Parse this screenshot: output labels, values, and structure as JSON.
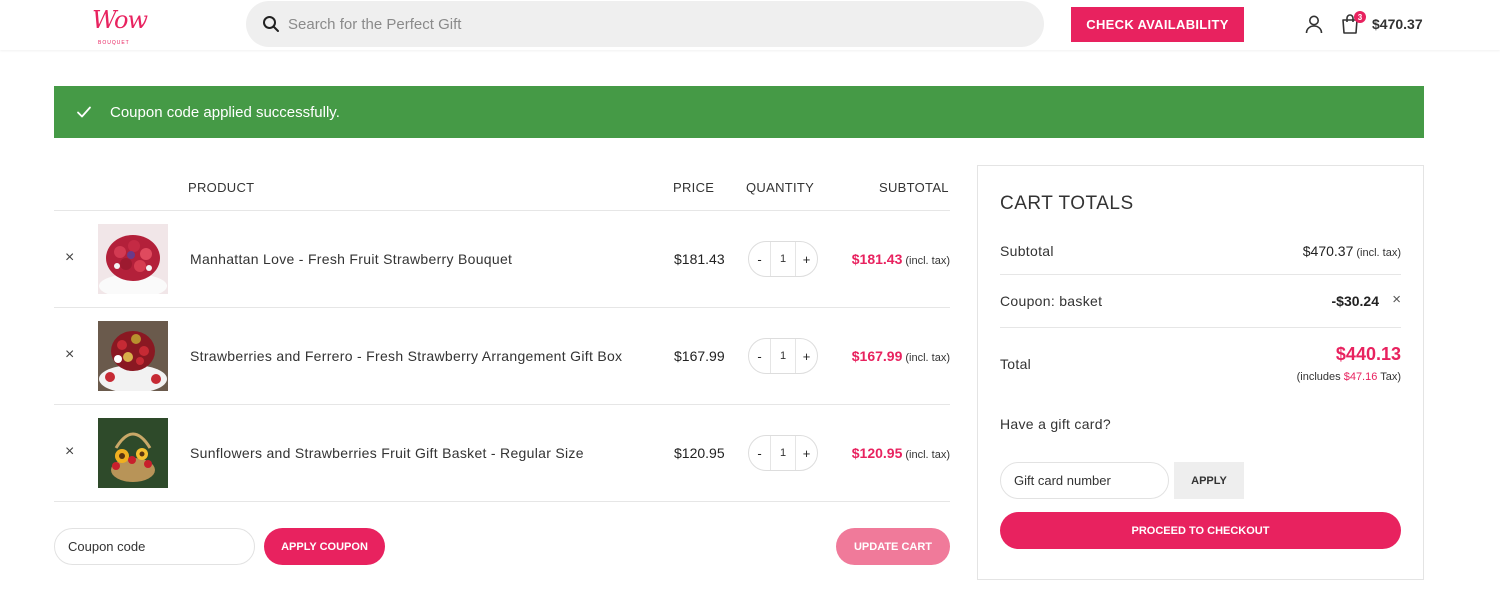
{
  "header": {
    "logo_text": "Wow",
    "logo_tagline": "BOUQUET",
    "search_placeholder": "Search for the Perfect Gift",
    "check_availability_label": "CHECK AVAILABILITY",
    "cart_count": "3",
    "cart_total": "$470.37"
  },
  "notice": {
    "message": "Coupon code applied successfully.",
    "color": "#459a46"
  },
  "table": {
    "headers": {
      "product": "PRODUCT",
      "price": "PRICE",
      "quantity": "QUANTITY",
      "subtotal": "SUBTOTAL"
    },
    "rows": [
      {
        "remove": "×",
        "name": "Manhattan Love - Fresh Fruit Strawberry Bouquet",
        "price": "$181.43",
        "qty_minus": "-",
        "qty": "1",
        "qty_plus": "+",
        "subtotal": "$181.43",
        "tax_note": "(incl. tax)"
      },
      {
        "remove": "×",
        "name": "Strawberries and Ferrero - Fresh Strawberry Arrangement Gift Box",
        "price": "$167.99",
        "qty_minus": "-",
        "qty": "1",
        "qty_plus": "+",
        "subtotal": "$167.99",
        "tax_note": "(incl. tax)"
      },
      {
        "remove": "×",
        "name": "Sunflowers and Strawberries Fruit Gift Basket - Regular Size",
        "price": "$120.95",
        "qty_minus": "-",
        "qty": "1",
        "qty_plus": "+",
        "subtotal": "$120.95",
        "tax_note": "(incl. tax)"
      }
    ]
  },
  "actions": {
    "coupon_placeholder": "Coupon code",
    "apply_coupon_label": "APPLY COUPON",
    "update_cart_label": "UPDATE CART"
  },
  "totals": {
    "title": "CART TOTALS",
    "subtotal_label": "Subtotal",
    "subtotal_value": "$470.37",
    "subtotal_tax": "(incl. tax)",
    "coupon_label": "Coupon: basket",
    "coupon_value": "-$30.24",
    "coupon_remove": "×",
    "total_label": "Total",
    "total_value": "$440.13",
    "includes_prefix": "(includes",
    "includes_amount": "$47.16",
    "includes_suffix": "Tax)",
    "gift_card_label": "Have a gift card?",
    "gift_card_placeholder": "Gift card number",
    "apply_label": "APPLY",
    "checkout_label": "PROCEED TO CHECKOUT"
  },
  "colors": {
    "accent": "#e8225f",
    "accent_light": "#f07a9a",
    "success": "#459a46"
  }
}
